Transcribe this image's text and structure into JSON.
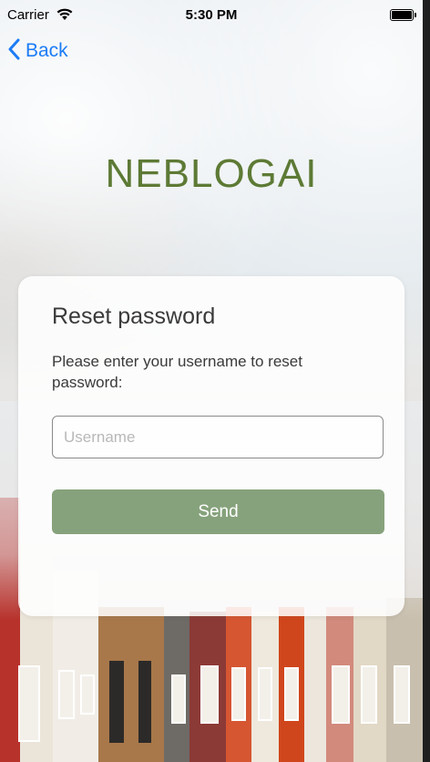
{
  "status_bar": {
    "carrier": "Carrier",
    "time": "5:30 PM"
  },
  "nav": {
    "back_label": "Back"
  },
  "app": {
    "logo_text": "NEBLOGAI"
  },
  "reset_card": {
    "title": "Reset password",
    "description": "Please enter your username to reset password:",
    "username_placeholder": "Username",
    "username_value": "",
    "send_label": "Send"
  },
  "colors": {
    "logo": "#5d7a35",
    "send_button": "#86a27c",
    "back_link": "#1c7cf5"
  }
}
